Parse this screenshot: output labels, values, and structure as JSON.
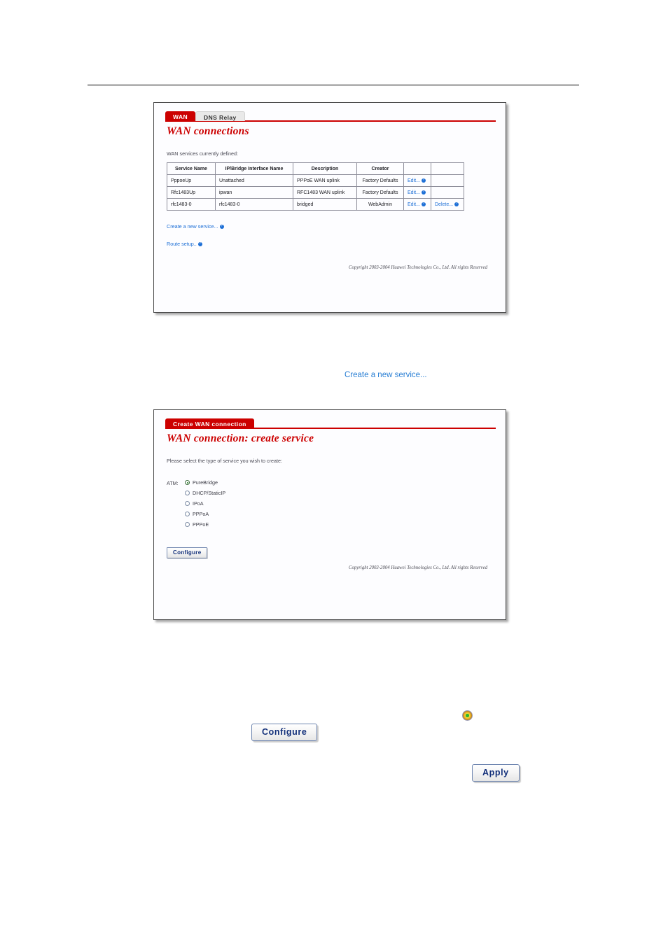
{
  "page": {
    "rule": true
  },
  "panel1": {
    "tabs": [
      {
        "label": "WAN",
        "active": true
      },
      {
        "label": "DNS Relay",
        "active": false
      }
    ],
    "title": "WAN connections",
    "intro": "WAN services currently defined:",
    "table": {
      "headers": [
        "Service Name",
        "IP/Bridge Interface Name",
        "Description",
        "Creator",
        "",
        ""
      ],
      "rows": [
        {
          "service_name": "PppoeUp",
          "interface": "Unattached",
          "description": "PPPoE WAN uplink",
          "creator": "Factory Defaults",
          "action1": "Edit...",
          "action2": ""
        },
        {
          "service_name": "Rfc1483Up",
          "interface": "ipwan",
          "description": "RFC1483 WAN uplink",
          "creator": "Factory Defaults",
          "action1": "Edit...",
          "action2": ""
        },
        {
          "service_name": "rfc1483-0",
          "interface": "rfc1483-0",
          "description": "bridged",
          "creator": "WebAdmin",
          "action1": "Edit...",
          "action2": "Delete..."
        }
      ]
    },
    "create_link": "Create a new service...",
    "route_link": "Route setup..",
    "copyright": "Copyright 2003-2004 Huawei Technologies Co., Ltd. All rights Reserved"
  },
  "callout_link": {
    "label": "Create a new service..."
  },
  "panel2": {
    "tabs": [
      {
        "label": "Create WAN connection",
        "active": true
      }
    ],
    "title": "WAN connection: create service",
    "intro": "Please select the type of service you wish to create:",
    "group_label": "ATM:",
    "options": [
      {
        "label": "PureBridge",
        "selected": true
      },
      {
        "label": "DHCP/StaticIP",
        "selected": false
      },
      {
        "label": "IPoA",
        "selected": false
      },
      {
        "label": "PPPoA",
        "selected": false
      },
      {
        "label": "PPPoE",
        "selected": false
      }
    ],
    "configure_button": "Configure",
    "copyright": "Copyright 2003-2004 Huawei Technologies Co., Ltd. All rights Reserved"
  },
  "callouts": {
    "configure_button": "Configure",
    "radio_icon": "radio-selected-icon",
    "apply_button": "Apply"
  },
  "colors": {
    "brand_red": "#cc0000",
    "link_blue": "#1d6fd6",
    "callout_blue": "#2a7fd4",
    "button_text": "#13307a"
  }
}
